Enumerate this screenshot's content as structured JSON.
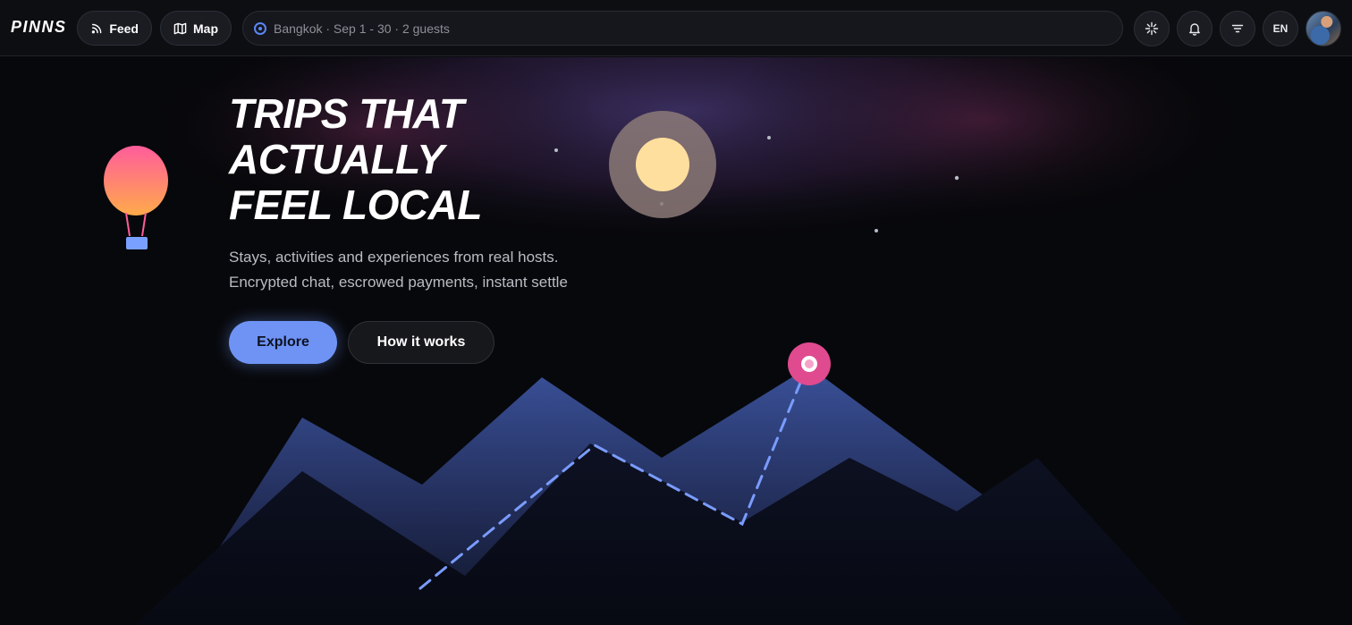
{
  "app": {
    "logo": "PINNS"
  },
  "nav": {
    "feed_label": "Feed",
    "map_label": "Map"
  },
  "search": {
    "location": "Bangkok",
    "dates": "Sep 1 - 30",
    "guests": "2 guests",
    "summary": "Bangkok · Sep 1 - 30 · 2 guests"
  },
  "actions": {
    "language": "EN",
    "icons": [
      "sparkle-icon",
      "bell-icon",
      "filter-icon"
    ]
  },
  "hero": {
    "headline": [
      "TRIPS THAT",
      "ACTUALLY",
      "FEEL LOCAL"
    ],
    "subtitle": [
      "Stays, activities and experiences from real hosts.",
      "Encrypted chat, escrowed payments, instant settle"
    ],
    "explore_label": "Explore",
    "how_label": "How it works"
  },
  "colors": {
    "accent": "#6e93f5",
    "pin": "#e04a8f",
    "background": "#07080b"
  }
}
